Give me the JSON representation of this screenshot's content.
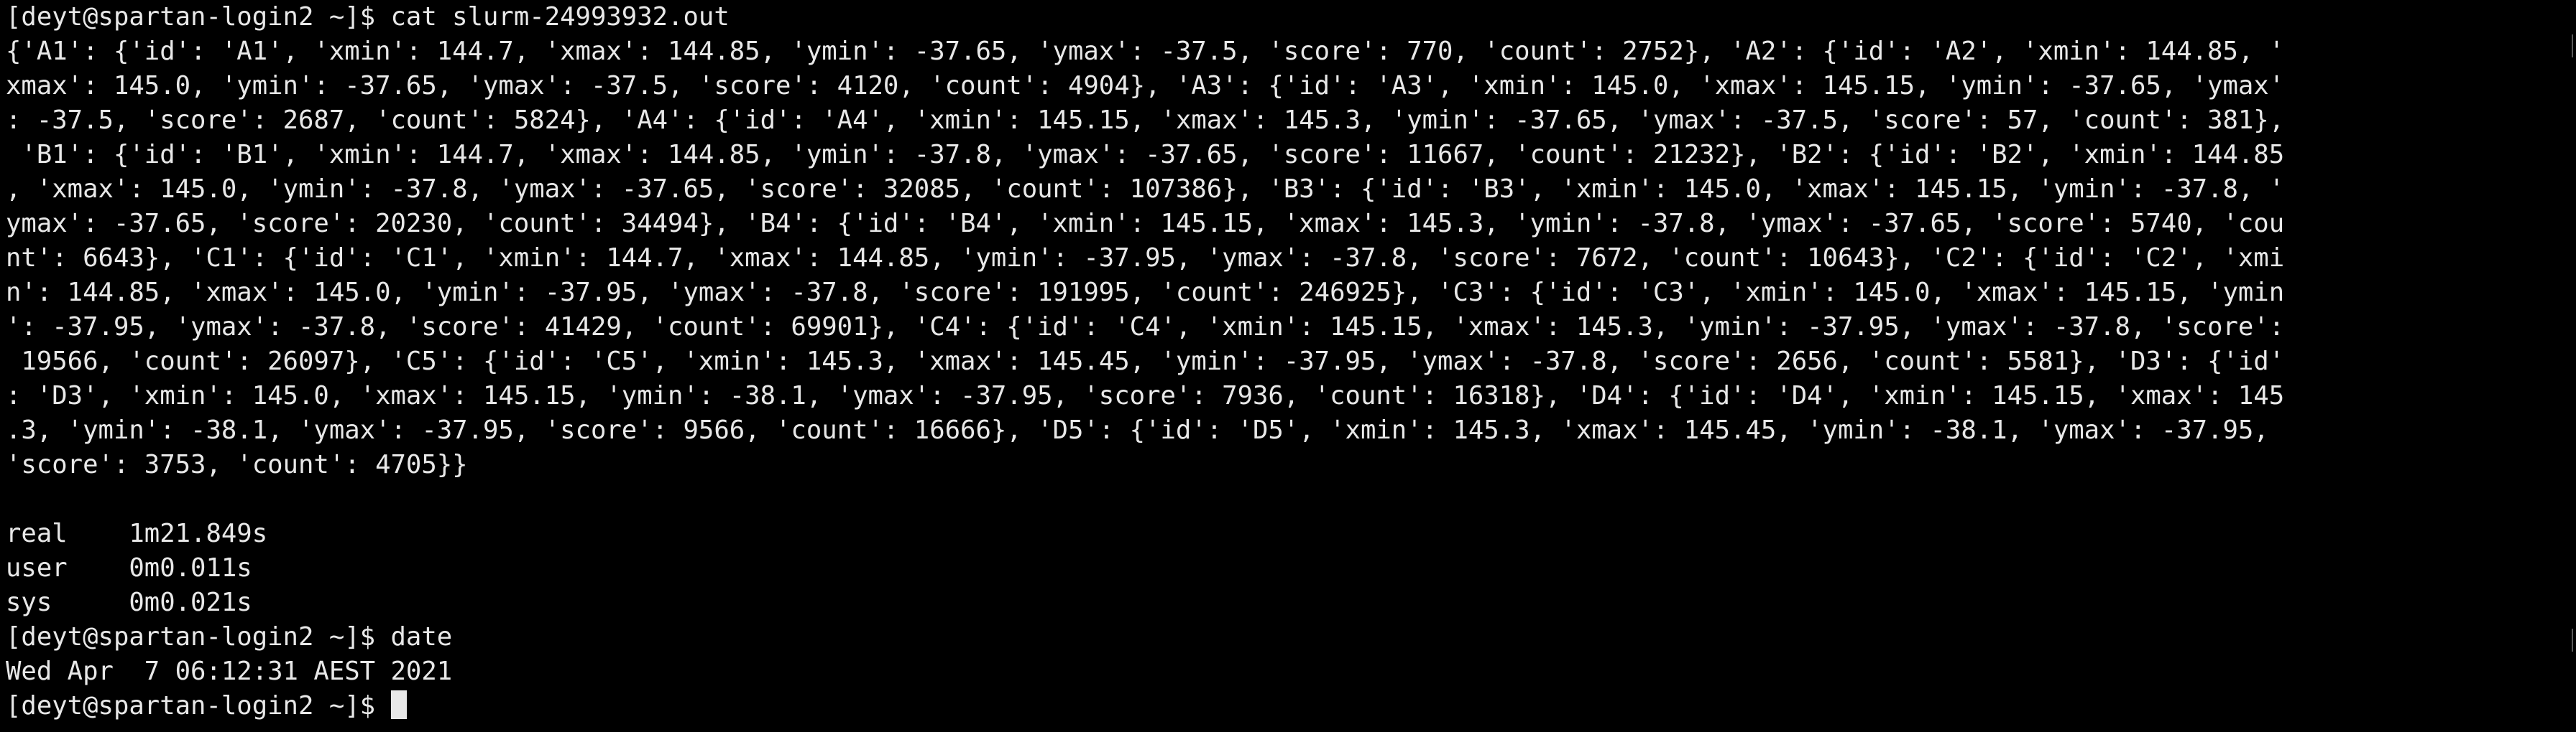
{
  "terminal": {
    "background_color": "#000000",
    "text_color": "#e8e8e8",
    "lines": [
      "[deyt@spartan-login2 ~]$ cat slurm-24993932.out",
      "{'A1': {'id': 'A1', 'xmin': 144.7, 'xmax': 144.85, 'ymin': -37.65, 'ymax': -37.5, 'score': 770, 'count': 2752}, 'A2': {'id': 'A2', 'xmin': 144.85, '",
      "xmax': 145.0, 'ymin': -37.65, 'ymax': -37.5, 'score': 4120, 'count': 4904}, 'A3': {'id': 'A3', 'xmin': 145.0, 'xmax': 145.15, 'ymin': -37.65, 'ymax'",
      ": -37.5, 'score': 2687, 'count': 5824}, 'A4': {'id': 'A4', 'xmin': 145.15, 'xmax': 145.3, 'ymin': -37.65, 'ymax': -37.5, 'score': 57, 'count': 381},",
      " 'B1': {'id': 'B1', 'xmin': 144.7, 'xmax': 144.85, 'ymin': -37.8, 'ymax': -37.65, 'score': 11667, 'count': 21232}, 'B2': {'id': 'B2', 'xmin': 144.85",
      ", 'xmax': 145.0, 'ymin': -37.8, 'ymax': -37.65, 'score': 32085, 'count': 107386}, 'B3': {'id': 'B3', 'xmin': 145.0, 'xmax': 145.15, 'ymin': -37.8, '",
      "ymax': -37.65, 'score': 20230, 'count': 34494}, 'B4': {'id': 'B4', 'xmin': 145.15, 'xmax': 145.3, 'ymin': -37.8, 'ymax': -37.65, 'score': 5740, 'cou",
      "nt': 6643}, 'C1': {'id': 'C1', 'xmin': 144.7, 'xmax': 144.85, 'ymin': -37.95, 'ymax': -37.8, 'score': 7672, 'count': 10643}, 'C2': {'id': 'C2', 'xmi",
      "n': 144.85, 'xmax': 145.0, 'ymin': -37.95, 'ymax': -37.8, 'score': 191995, 'count': 246925}, 'C3': {'id': 'C3', 'xmin': 145.0, 'xmax': 145.15, 'ymin",
      "': -37.95, 'ymax': -37.8, 'score': 41429, 'count': 69901}, 'C4': {'id': 'C4', 'xmin': 145.15, 'xmax': 145.3, 'ymin': -37.95, 'ymax': -37.8, 'score':",
      " 19566, 'count': 26097}, 'C5': {'id': 'C5', 'xmin': 145.3, 'xmax': 145.45, 'ymin': -37.95, 'ymax': -37.8, 'score': 2656, 'count': 5581}, 'D3': {'id'",
      ": 'D3', 'xmin': 145.0, 'xmax': 145.15, 'ymin': -38.1, 'ymax': -37.95, 'score': 7936, 'count': 16318}, 'D4': {'id': 'D4', 'xmin': 145.15, 'xmax': 145",
      ".3, 'ymin': -38.1, 'ymax': -37.95, 'score': 9566, 'count': 16666}, 'D5': {'id': 'D5', 'xmin': 145.3, 'xmax': 145.45, 'ymin': -38.1, 'ymax': -37.95,",
      "'score': 3753, 'count': 4705}}",
      "",
      "real    1m21.849s",
      "user    0m0.011s",
      "sys     0m0.021s",
      "[deyt@spartan-login2 ~]$ date",
      "Wed Apr  7 06:12:31 AEST 2021",
      "[deyt@spartan-login2 ~]$ "
    ]
  }
}
